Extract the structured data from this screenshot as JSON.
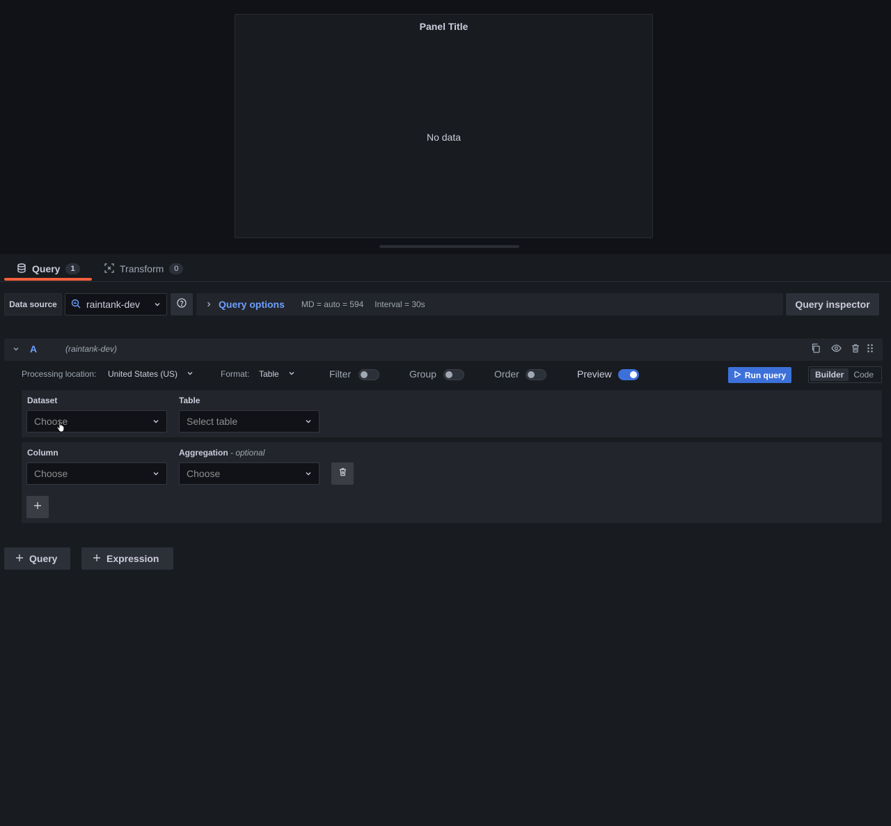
{
  "panel": {
    "title": "Panel Title",
    "no_data": "No data"
  },
  "tabs": [
    {
      "label": "Query",
      "count": "1",
      "icon": "database-icon",
      "active": true
    },
    {
      "label": "Transform",
      "count": "0",
      "icon": "transform-icon",
      "active": false
    }
  ],
  "datasource": {
    "label": "Data source",
    "selected": "raintank-dev",
    "icon": "bigquery-icon"
  },
  "query_options": {
    "title": "Query options",
    "md": "MD = auto = 594",
    "interval": "Interval = 30s"
  },
  "query_inspector": "Query inspector",
  "query_row": {
    "ref_id": "A",
    "datasource": "(raintank-dev)",
    "actions": [
      "duplicate-icon",
      "eye-icon",
      "trash-icon",
      "drag-handle-icon"
    ]
  },
  "query_header": {
    "processing_label": "Processing location:",
    "processing_value": "United States (US)",
    "format_label": "Format:",
    "format_value": "Table",
    "filter_label": "Filter",
    "group_label": "Group",
    "order_label": "Order",
    "preview_label": "Preview",
    "filter_on": false,
    "group_on": false,
    "order_on": false,
    "preview_on": true,
    "run_query": "Run query",
    "mode_builder": "Builder",
    "mode_code": "Code",
    "active_mode": "Builder"
  },
  "dataset_section": {
    "dataset_label": "Dataset",
    "dataset_placeholder": "Choose",
    "table_label": "Table",
    "table_placeholder": "Select table"
  },
  "column_section": {
    "column_label": "Column",
    "column_placeholder": "Choose",
    "aggregation_label": "Aggregation",
    "aggregation_optional": " - optional",
    "aggregation_placeholder": "Choose"
  },
  "bottom_buttons": {
    "add_query": "Query",
    "add_expression": "Expression"
  },
  "colors": {
    "accent_blue": "#3d71d9",
    "link_blue": "#6e9fff",
    "tab_underline": "#f55f3e",
    "background": "#111217",
    "panel_bg": "#181b1f"
  }
}
